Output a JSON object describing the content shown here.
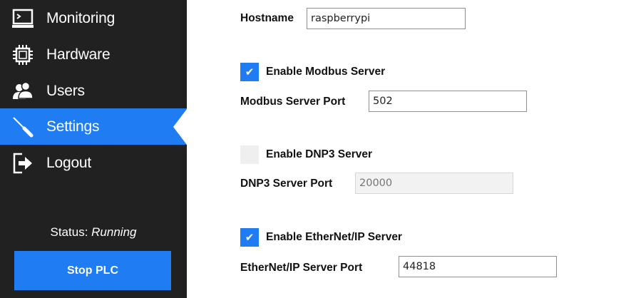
{
  "sidebar": {
    "items": [
      {
        "label": "Monitoring",
        "icon": "monitor-icon"
      },
      {
        "label": "Hardware",
        "icon": "chip-icon"
      },
      {
        "label": "Users",
        "icon": "users-icon"
      },
      {
        "label": "Settings",
        "icon": "screwdriver-icon",
        "active": true
      },
      {
        "label": "Logout",
        "icon": "logout-icon"
      }
    ],
    "status_prefix": "Status:",
    "status_value": "Running",
    "stop_button_label": "Stop PLC"
  },
  "settings": {
    "hostname": {
      "label": "Hostname",
      "value": "raspberrypi"
    },
    "modbus": {
      "enable_label": "Enable Modbus Server",
      "checked": true,
      "port_label": "Modbus Server Port",
      "port_value": "502"
    },
    "dnp3": {
      "enable_label": "Enable DNP3 Server",
      "checked": false,
      "port_label": "DNP3 Server Port",
      "port_placeholder": "20000"
    },
    "ethernet_ip": {
      "enable_label": "Enable EtherNet/IP Server",
      "checked": true,
      "port_label": "EtherNet/IP Server Port",
      "port_value": "44818"
    }
  },
  "colors": {
    "sidebar_bg": "#212121",
    "accent": "#1F7CF2",
    "text_light": "#FFFFFF"
  }
}
